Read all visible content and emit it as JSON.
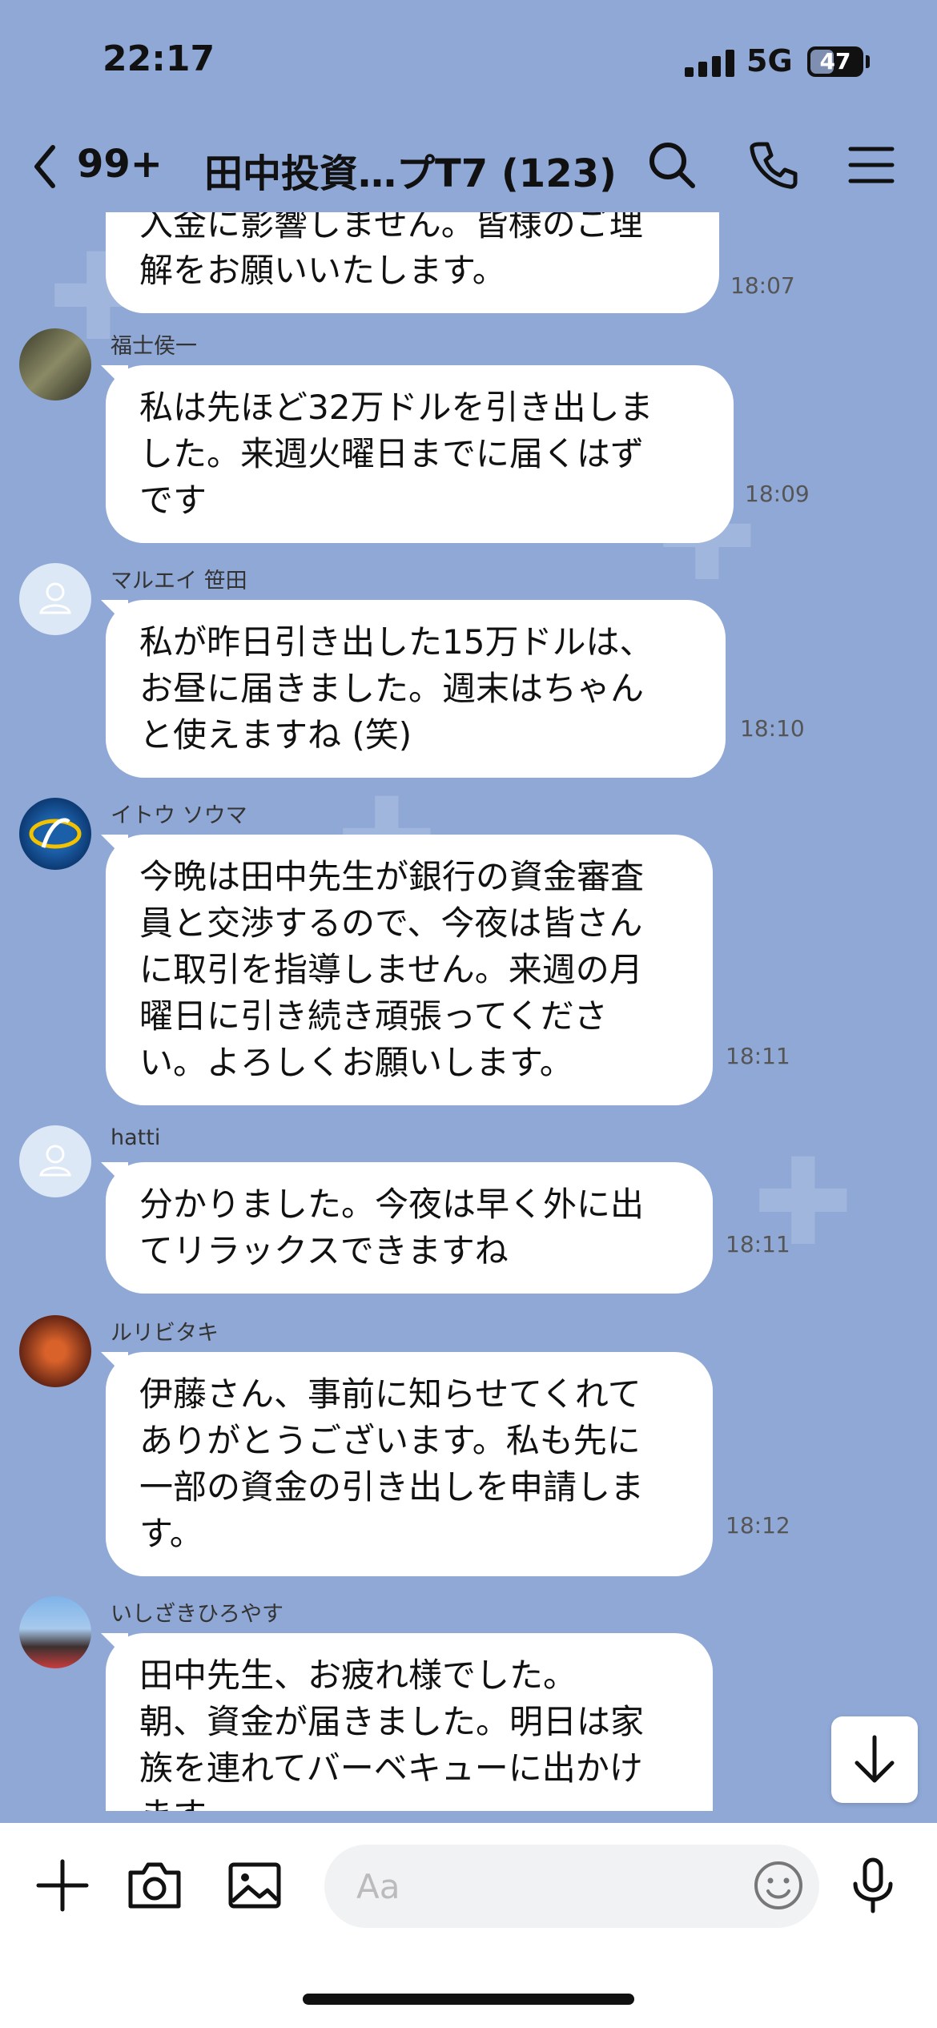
{
  "status_bar": {
    "time": "22:17",
    "network": "5G",
    "battery": "47",
    "battery_fraction": 0.47
  },
  "header": {
    "unread_count": "99+",
    "title": "田中投資…プT7 (123)",
    "icons": [
      "back-chevron-icon",
      "search-icon",
      "phone-icon",
      "menu-icon"
    ]
  },
  "messages": [
    {
      "sender": "",
      "avatar": "",
      "text": "入金に影響しません。皆様のご理\n解をお願いいたします。",
      "time": "18:07"
    },
    {
      "sender": "福士侯一",
      "avatar": "photo",
      "text": "私は先ほど32万ドルを引き出しま\nした。来週火曜日までに届くはず\nです",
      "time": "18:09"
    },
    {
      "sender": "マルエイ 笹田",
      "avatar": "default-user-icon",
      "text": "私が昨日引き出した15万ドルは、\nお昼に届きました。週末はちゃん\nと使えますね (笑)",
      "time": "18:10"
    },
    {
      "sender": "イトウ ソウマ",
      "avatar": "logo",
      "text": "今晩は田中先生が銀行の資金審査\n員と交渉するので、今夜は皆さん\nに取引を指導しません。来週の月\n曜日に引き続き頑張ってくださ\nい。よろしくお願いします。",
      "time": "18:11"
    },
    {
      "sender": "hatti",
      "avatar": "default-user-icon",
      "text": "分かりました。今夜は早く外に出\nてリラックスできますね",
      "time": "18:11"
    },
    {
      "sender": "ルリビタキ",
      "avatar": "photo",
      "text": "伊藤さん、事前に知らせてくれて\nありがとうございます。私も先に\n一部の資金の引き出しを申請しま\nす。",
      "time": "18:12"
    },
    {
      "sender": "いしざきひろやす",
      "avatar": "photo",
      "text": "田中先生、お疲れ様でした。\n朝、資金が届きました。明日は家\n族を連れてバーベキューに出かけ\nます",
      "time": ""
    }
  ],
  "input": {
    "placeholder": "Aa"
  },
  "colors": {
    "background": "#8fa8d6",
    "bubble": "#ffffff"
  }
}
